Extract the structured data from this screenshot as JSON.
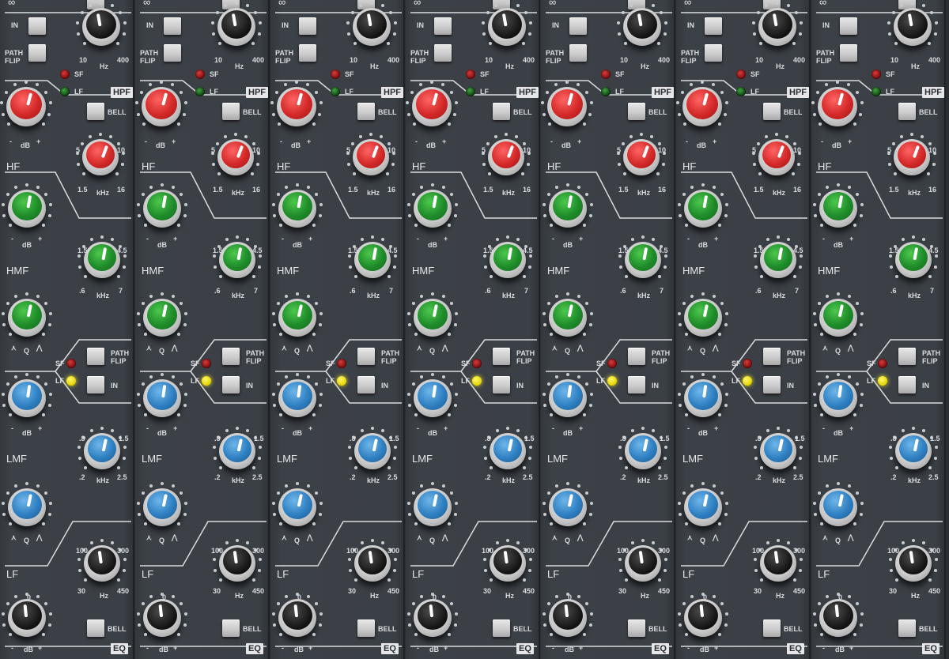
{
  "strips": [
    {
      "id": "1"
    },
    {
      "id": "2"
    },
    {
      "id": "3"
    },
    {
      "id": "4"
    },
    {
      "id": "5"
    },
    {
      "id": "6"
    },
    {
      "id": "7"
    }
  ],
  "labels": {
    "infinity": "∞",
    "in": "IN",
    "path_flip": "PATH\nFLIP",
    "hz": "Hz",
    "hz_min": "10",
    "hz_max": "400",
    "sf": "SF",
    "lf_led": "LF",
    "hpf": "HPF",
    "bell": "BELL",
    "db": "dB",
    "minus": "-",
    "plus": "+",
    "hf": "HF",
    "khz": "kHz",
    "hf_min": "1.5",
    "hf_max": "16",
    "hf_mid_l": "5",
    "hf_mid_r": "10",
    "hmf": "HMF",
    "hmf_top_l": "1.5",
    "hmf_top_r": "4.5",
    "hmf_min": ".6",
    "hmf_max": "7",
    "q": "Q",
    "lmf": "LMF",
    "lmf_top_l": ".8",
    "lmf_top_r": "1.5",
    "lmf_min": ".2",
    "lmf_max": "2.5",
    "lf": "LF",
    "lf_top_l": "100",
    "lf_top_r": "300",
    "lf_min": "30",
    "lf_max": "450",
    "zero": "0",
    "eq": "EQ"
  },
  "colors": {
    "panel": "#3b4046",
    "red": "#d42929",
    "green": "#1f8c2a",
    "blue": "#2f80c2",
    "black": "#111111",
    "led_red": "#a01010",
    "led_green": "#1f5a1f",
    "led_yellow": "#f5ea2d"
  },
  "icons": {
    "q_wide": "⋏",
    "q_narrow": "⋀"
  }
}
